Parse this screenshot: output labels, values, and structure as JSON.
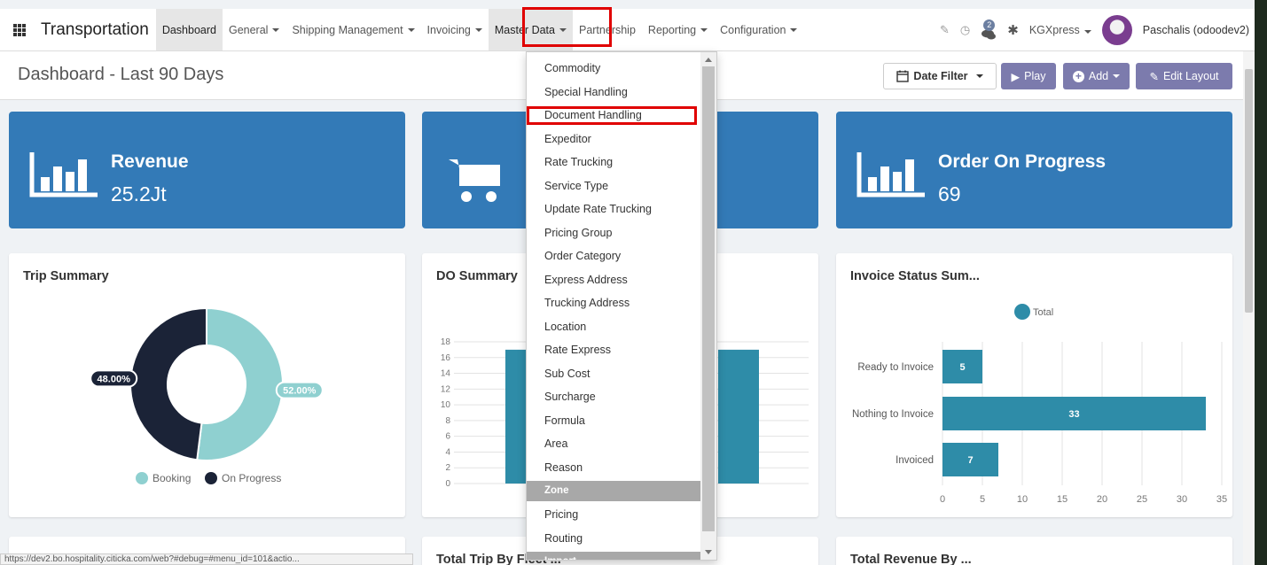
{
  "app": {
    "title": "Transportation"
  },
  "nav": {
    "items": [
      {
        "label": "Dashboard",
        "caret": false,
        "active": true
      },
      {
        "label": "General",
        "caret": true
      },
      {
        "label": "Shipping Management",
        "caret": true
      },
      {
        "label": "Invoicing",
        "caret": true
      },
      {
        "label": "Master Data",
        "caret": true
      },
      {
        "label": "Partnership",
        "caret": false
      },
      {
        "label": "Reporting",
        "caret": true
      },
      {
        "label": "Configuration",
        "caret": true
      }
    ],
    "messages_count": "2",
    "company": "KGXpress",
    "user": "Paschalis (odoodev2)"
  },
  "control": {
    "title": "Dashboard - Last 90 Days",
    "date_filter": "Date Filter",
    "play": "Play",
    "add": "Add",
    "edit_layout": "Edit Layout"
  },
  "kpis": [
    {
      "label": "Revenue",
      "value": "25.2Jt"
    },
    {
      "label": "",
      "value": ""
    },
    {
      "label": "Order On Progress",
      "value": "69"
    }
  ],
  "panels": {
    "trip_summary": "Trip Summary",
    "do_summary": "DO Summary",
    "invoice_status": "Invoice Status Sum...",
    "total_trip": "Total Trip By Fleet ...",
    "total_revenue": "Total Revenue By ..."
  },
  "dropdown": {
    "items": [
      {
        "label": "Commodity"
      },
      {
        "label": "Special Handling"
      },
      {
        "label": "Document Handling"
      },
      {
        "label": "Expeditor"
      },
      {
        "label": "Rate Trucking"
      },
      {
        "label": "Service Type"
      },
      {
        "label": "Update Rate Trucking"
      },
      {
        "label": "Pricing Group"
      },
      {
        "label": "Order Category"
      },
      {
        "label": "Express Address"
      },
      {
        "label": "Trucking Address"
      },
      {
        "label": "Location"
      },
      {
        "label": "Rate Express"
      },
      {
        "label": "Sub Cost"
      },
      {
        "label": "Surcharge"
      },
      {
        "label": "Formula"
      },
      {
        "label": "Area"
      },
      {
        "label": "Reason"
      },
      {
        "label": "Zone",
        "header": true
      },
      {
        "label": "Pricing"
      },
      {
        "label": "Routing"
      },
      {
        "label": "Import",
        "header": true
      }
    ]
  },
  "status_url": "https://dev2.bo.hospitality.citicka.com/web?#debug=#menu_id=101&actio...",
  "colors": {
    "tile": "#337ab7",
    "button": "#7c7bad",
    "booking": "#8fd0d0",
    "on_progress": "#1b2337",
    "bar": "#2e8ca8"
  },
  "chart_data": [
    {
      "type": "pie",
      "title": "Trip Summary",
      "labels": [
        "Booking",
        "On Progress"
      ],
      "values": [
        52.0,
        48.0
      ],
      "data_labels": [
        "52.00%",
        "48.00%"
      ],
      "colors": [
        "#8fd0d0",
        "#1b2337"
      ],
      "legend": "bottom"
    },
    {
      "type": "bar",
      "title": "DO Summary",
      "yticks": [
        "18",
        "16",
        "14",
        "12",
        "10",
        "8",
        "6",
        "4",
        "2",
        "0"
      ],
      "ylim": [
        0,
        18
      ],
      "series": [
        {
          "values": [
            17,
            17
          ]
        }
      ],
      "grid": true
    },
    {
      "type": "bar",
      "orientation": "horizontal",
      "title": "Invoice Status Sum...",
      "categories": [
        "Ready to Invoice",
        "Nothing to Invoice",
        "Invoiced"
      ],
      "series": [
        {
          "name": "Total",
          "values": [
            5,
            33,
            7
          ]
        }
      ],
      "xticks": [
        "0",
        "5",
        "10",
        "15",
        "20",
        "25",
        "30",
        "35"
      ],
      "xlim": [
        0,
        35
      ],
      "legend": "top",
      "grid": true
    }
  ]
}
